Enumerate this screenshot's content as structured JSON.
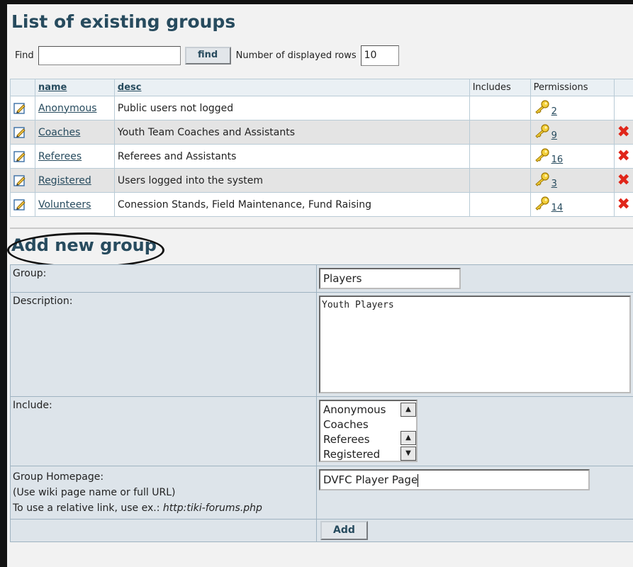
{
  "header": {
    "title": "List of existing groups"
  },
  "find": {
    "label": "Find",
    "value": "",
    "button": "find",
    "rows_label": "Number of displayed rows",
    "rows_value": "10"
  },
  "table": {
    "headers": {
      "name": "name",
      "desc": "desc",
      "includes": "Includes",
      "permissions": "Permissions"
    },
    "rows": [
      {
        "name": "Anonymous",
        "desc": "Public users not logged",
        "perm": "2",
        "delete": false
      },
      {
        "name": "Coaches",
        "desc": "Youth Team Coaches and Assistants",
        "perm": "9",
        "delete": true
      },
      {
        "name": "Referees",
        "desc": "Referees and Assistants",
        "perm": "16",
        "delete": true
      },
      {
        "name": "Registered",
        "desc": "Users logged into the system",
        "perm": "3",
        "delete": true
      },
      {
        "name": "Volunteers",
        "desc": "Conession Stands, Field Maintenance, Fund Raising",
        "perm": "14",
        "delete": true
      }
    ],
    "delete_icon": "✖"
  },
  "add": {
    "title": "Add new group",
    "group_label": "Group:",
    "group_value": "Players",
    "description_label": "Description:",
    "description_value": "Youth Players",
    "include_label": "Include:",
    "include_options": [
      "Anonymous",
      "Coaches",
      "Referees",
      "Registered"
    ],
    "homepage_label": "Group Homepage:",
    "homepage_hint1": "(Use wiki page name or full URL)",
    "homepage_hint2_prefix": "To use a relative link, use ex.: ",
    "homepage_hint2_example": "http:tiki-forums.php",
    "homepage_value": "DVFC Player Page",
    "button": "Add"
  },
  "icons": {
    "edit": "edit-icon",
    "key": "key-icon",
    "delete": "delete-icon"
  },
  "colors": {
    "link": "#274b5e",
    "delete": "#e0261a",
    "key": "#e6b800"
  }
}
